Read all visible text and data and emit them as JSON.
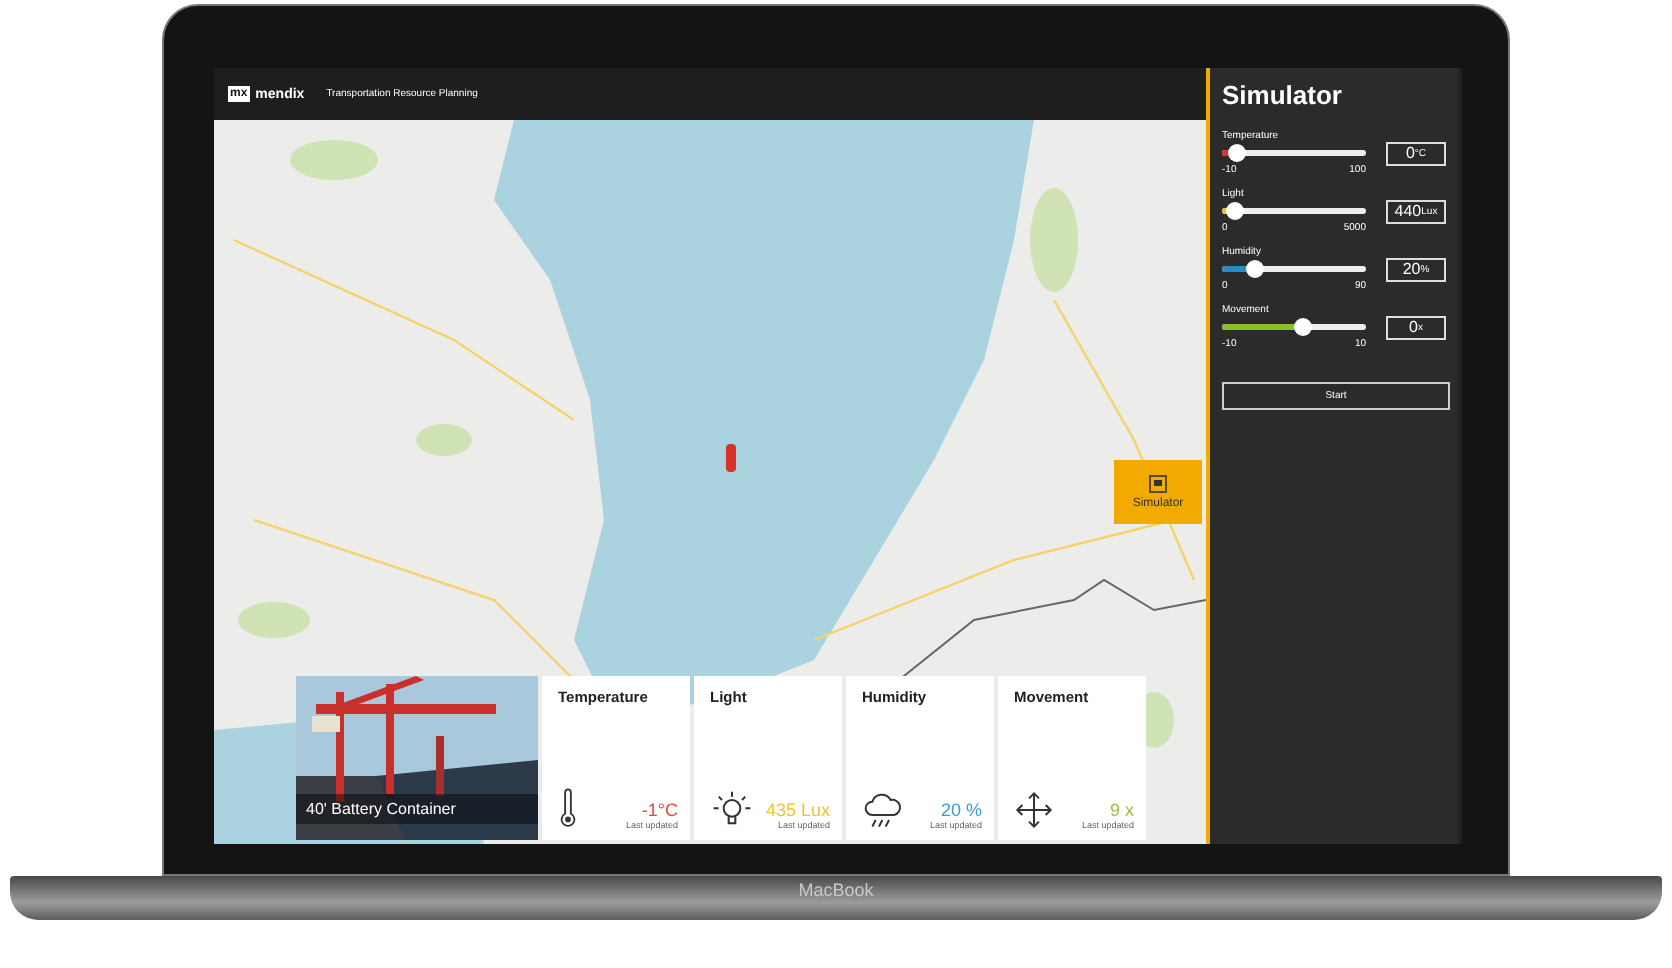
{
  "app": {
    "logo_mark": "mx",
    "logo_text": "mendix",
    "title": "Transportation Resource Planning"
  },
  "map": {
    "kind": "picture",
    "simulator_button": "Simulator"
  },
  "container": {
    "caption": "40' Battery Container"
  },
  "sensors": [
    {
      "kind": "thermometer",
      "title": "Temperature",
      "value": "-1°C",
      "color": "#e8473f",
      "updated": "Last updated"
    },
    {
      "kind": "bulb",
      "title": "Light",
      "value": "435 Lux",
      "color": "#f2c12e",
      "updated": "Last updated"
    },
    {
      "kind": "cloud",
      "title": "Humidity",
      "value": "20 %",
      "color": "#3f9bd1",
      "updated": "Last updated"
    },
    {
      "kind": "arrows",
      "title": "Movement",
      "value": "9 x",
      "color": "#9cc23a",
      "updated": "Last updated"
    }
  ],
  "simulator": {
    "title": "Simulator",
    "start": "Start",
    "sliders": [
      {
        "label": "Temperature",
        "min": "-10",
        "max": "100",
        "level": 0.1,
        "value": "0",
        "unit": "°C",
        "color": "#d9322b"
      },
      {
        "label": "Light",
        "min": "0",
        "max": "5000",
        "level": 0.09,
        "value": "440",
        "unit": "Lux",
        "color": "#f2c12e"
      },
      {
        "label": "Humidity",
        "min": "0",
        "max": "90",
        "level": 0.22,
        "value": "20",
        "unit": "%",
        "color": "#2a8ac7"
      },
      {
        "label": "Movement",
        "min": "-10",
        "max": "10",
        "level": 0.55,
        "value": "0",
        "unit": "x",
        "color": "#8cbf26"
      }
    ]
  },
  "laptop": {
    "label": "MacBook"
  }
}
